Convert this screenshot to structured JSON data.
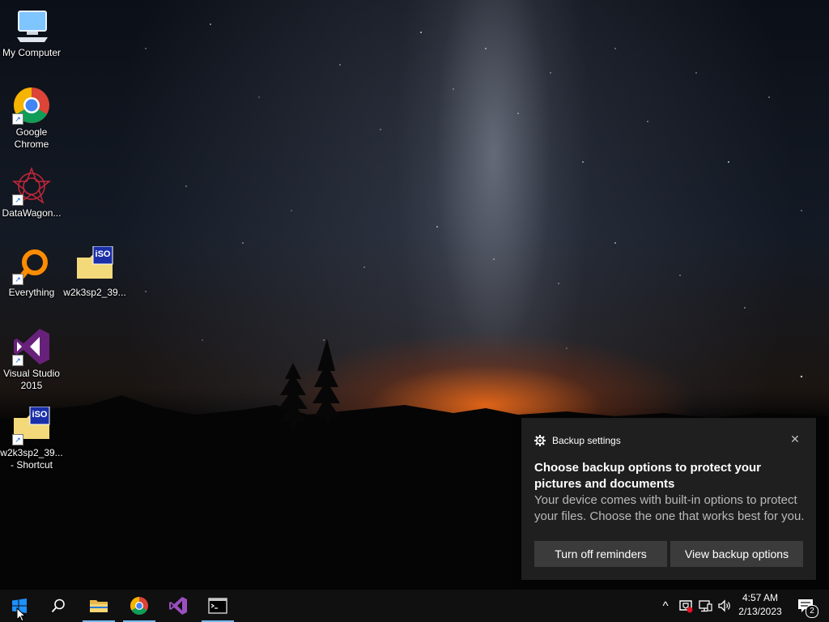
{
  "desktop": {
    "icons": [
      {
        "name": "my-computer",
        "label": "My Computer"
      },
      {
        "name": "google-chrome",
        "label": "Google Chrome"
      },
      {
        "name": "datawagon",
        "label": "DataWagon..."
      },
      {
        "name": "everything",
        "label": "Everything"
      },
      {
        "name": "iso-file",
        "label": "w2k3sp2_39..."
      },
      {
        "name": "visual-studio",
        "label": "Visual Studio 2015"
      },
      {
        "name": "iso-shortcut",
        "label": "w2k3sp2_39... - Shortcut"
      }
    ],
    "iso_badge_text": "iSO",
    "icon_shortcut_arrow": "arrow-shortcut-overlay"
  },
  "toast": {
    "app_icon": "gear-icon",
    "app_name": "Backup settings",
    "close_glyph": "✕",
    "title": "Choose backup options to protect your pictures and documents",
    "body": "Your device comes with built-in options to protect your files. Choose the one that works best for you.",
    "buttons": {
      "turn_off": "Turn off reminders",
      "view": "View backup options"
    }
  },
  "taskbar": {
    "apps": [
      {
        "name": "start",
        "icon": "windows-logo-icon"
      },
      {
        "name": "search",
        "icon": "search-icon"
      },
      {
        "name": "file-explorer",
        "icon": "folder-icon"
      },
      {
        "name": "chrome",
        "icon": "chrome-icon"
      },
      {
        "name": "visual-studio",
        "icon": "visual-studio-icon"
      },
      {
        "name": "command-prompt",
        "icon": "terminal-icon"
      }
    ],
    "tray": {
      "chevron": "^",
      "icons": [
        "security-shield-icon",
        "network-icon",
        "volume-icon"
      ],
      "notification_count": "2"
    },
    "clock": {
      "time": "4:57 AM",
      "date": "2/13/2023"
    }
  },
  "colors": {
    "taskbar": "#101010",
    "toast_bg": "#1f1f1f",
    "toast_button": "#3b3b3b",
    "accent": "#76b9ed",
    "vs_purple": "#68217a"
  }
}
